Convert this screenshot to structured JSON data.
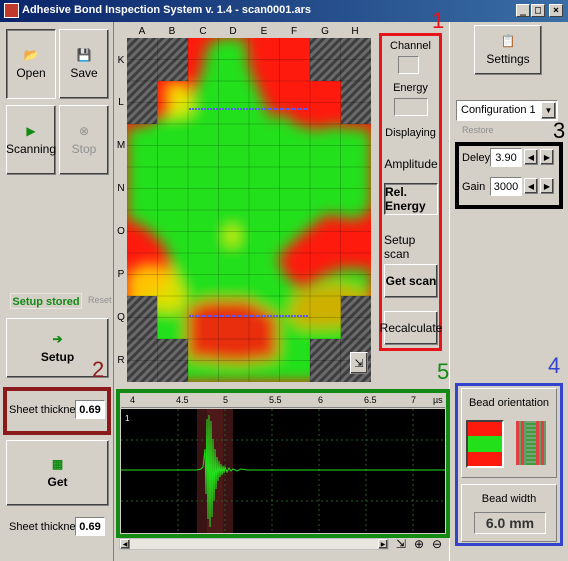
{
  "window": {
    "title": "Adhesive Bond Inspection System  v. 1.4 - scan0001.ars",
    "min": "_",
    "max": "□",
    "close": "×"
  },
  "toolbar": {
    "open": "Open",
    "save": "Save",
    "scanning": "Scanning",
    "stop": "Stop"
  },
  "setup_status": {
    "stored": "Setup stored",
    "reset": "Reset"
  },
  "setup_button": "Setup",
  "get_button": "Get",
  "sheet_thickness_1": {
    "label": "Sheet thickness",
    "value": "0.69"
  },
  "sheet_thickness_2": {
    "label": "Sheet thickness",
    "value": "0.69"
  },
  "grid": {
    "columns": [
      "A",
      "B",
      "C",
      "D",
      "E",
      "F",
      "G",
      "H"
    ],
    "rows": [
      "K",
      "L",
      "M",
      "N",
      "O",
      "P",
      "Q",
      "R"
    ]
  },
  "channel_panel": {
    "channel": "Channel",
    "energy": "Energy",
    "displaying": "Displaying",
    "amplitude": "Amplitude",
    "rel_energy": "Rel. Energy",
    "setup_scan": "Setup scan",
    "get_scan": "Get scan",
    "recalculate": "Recalculate"
  },
  "settings_button": "Settings",
  "configuration": {
    "selected": "Configuration 1",
    "restore": "Restore"
  },
  "delay": {
    "label": "Deley",
    "value": "3.90"
  },
  "gain": {
    "label": "Gain",
    "value": "3000"
  },
  "bead": {
    "orientation_label": "Bead orientation",
    "width_label": "Bead width",
    "width_value": "6.0 mm"
  },
  "waveform": {
    "ticks": [
      "4",
      "4.5",
      "5",
      "5.5",
      "6",
      "6.5",
      "7"
    ],
    "unit": "µs",
    "channel_label": "1"
  },
  "annotations": [
    "1",
    "2",
    "3",
    "4",
    "5"
  ],
  "colors": {
    "annotation_red": "#e8141c",
    "annotation_dark_red": "#8b1a1a",
    "annotation_black": "#000000",
    "annotation_blue": "#3344cc",
    "annotation_green": "#138a13",
    "map_green": "#22e01a",
    "map_red": "#ff1a0e",
    "map_yellow": "#f2f000"
  }
}
